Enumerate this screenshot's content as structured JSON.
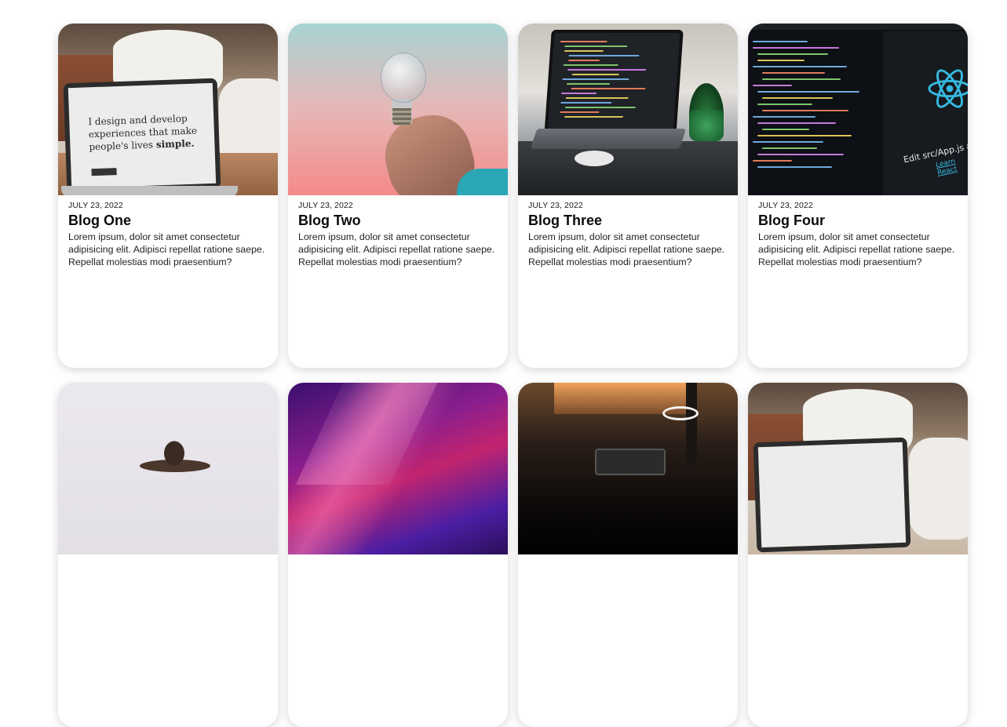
{
  "posts": [
    {
      "date": "JULY 23, 2022",
      "title": "Blog One",
      "excerpt": "Lorem ipsum, dolor sit amet consectetur adipisicing elit. Adipisci repellat ratione saepe. Repellat molestias modi praesentium?",
      "image": "laptop-design-photo",
      "screen_text_1": "I design and develop",
      "screen_text_2": "experiences that make",
      "screen_text_3": "people's lives",
      "screen_text_bold": "simple."
    },
    {
      "date": "JULY 23, 2022",
      "title": "Blog Two",
      "excerpt": "Lorem ipsum, dolor sit amet consectetur adipisicing elit. Adipisci repellat ratione saepe. Repellat molestias modi praesentium?",
      "image": "light-bulb-photo"
    },
    {
      "date": "JULY 23, 2022",
      "title": "Blog Three",
      "excerpt": "Lorem ipsum, dolor sit amet consectetur adipisicing elit. Adipisci repellat ratione saepe. Repellat molestias modi praesentium?",
      "image": "laptop-code-photo"
    },
    {
      "date": "JULY 23, 2022",
      "title": "Blog Four",
      "excerpt": "Lorem ipsum, dolor sit amet consectetur adipisicing elit. Adipisci repellat ratione saepe. Repellat molestias modi praesentium?",
      "image": "react-code-photo",
      "screen_text_edit": "Edit src/App.js and s",
      "screen_text_link": "Learn React"
    },
    {
      "image": "dancer-photo"
    },
    {
      "image": "galaxy-photo"
    },
    {
      "image": "night-room-laptop-photo"
    },
    {
      "image": "laptop-design-photo"
    }
  ],
  "colors": {
    "background": "#ffffff",
    "card": "#ffffff",
    "title": "#0c0c0c",
    "text": "#222222",
    "react_blue": "#35b9e0"
  }
}
